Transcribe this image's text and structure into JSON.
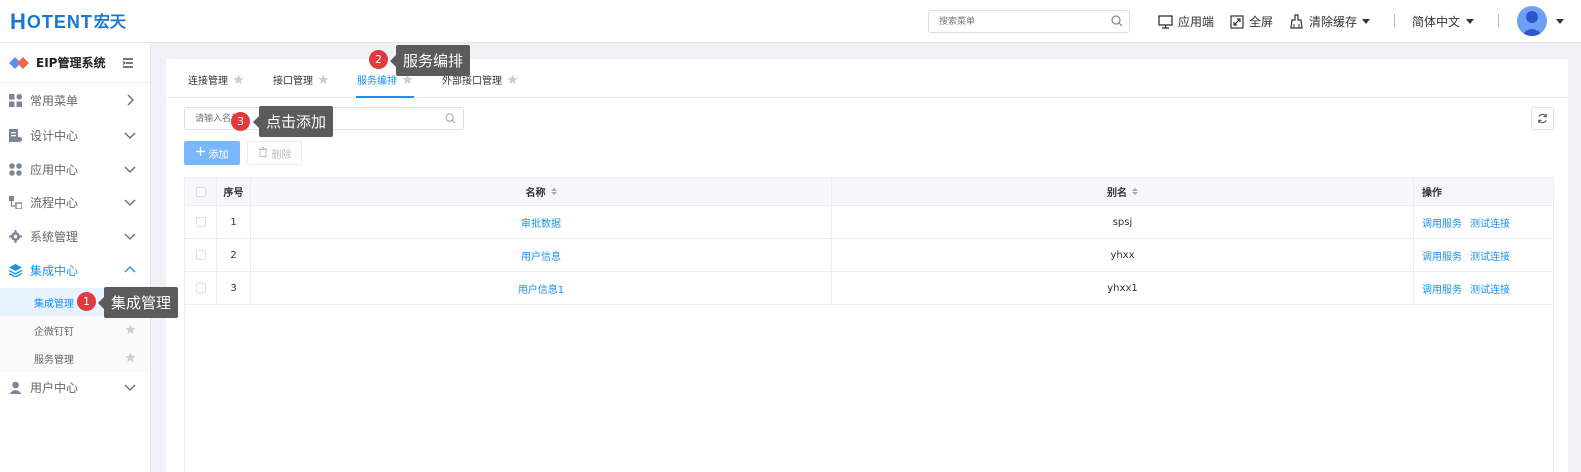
{
  "header": {
    "logo_main": "H",
    "logo_text": "OTENT",
    "logo_cn": "宏天",
    "search_placeholder": "搜索菜单",
    "app_client": "应用端",
    "fullscreen": "全屏",
    "clear_cache": "清除缓存",
    "language": "简体中文"
  },
  "sidebar": {
    "title": "EIP管理系统",
    "items": [
      {
        "label": "常用菜单",
        "icon": "grid-icon"
      },
      {
        "label": "设计中心",
        "icon": "design-icon"
      },
      {
        "label": "应用中心",
        "icon": "apps-icon"
      },
      {
        "label": "流程中心",
        "icon": "flow-icon"
      },
      {
        "label": "系统管理",
        "icon": "gear-icon"
      },
      {
        "label": "集成中心",
        "icon": "layers-icon"
      },
      {
        "label": "用户中心",
        "icon": "user-icon"
      }
    ],
    "subitems": [
      {
        "label": "集成管理"
      },
      {
        "label": "企微钉钉"
      },
      {
        "label": "服务管理"
      }
    ]
  },
  "tabs": [
    {
      "label": "连接管理"
    },
    {
      "label": "接口管理"
    },
    {
      "label": "服务编排"
    },
    {
      "label": "外部接口管理"
    }
  ],
  "toolbar": {
    "filter_placeholder": "请输入名称",
    "add_label": "添加",
    "delete_label": "删除"
  },
  "table": {
    "headers": {
      "index": "序号",
      "name": "名称",
      "alias": "别名",
      "ops": "操作"
    },
    "rows": [
      {
        "index": "1",
        "name": "审批数据",
        "alias": "spsj",
        "op1": "调用服务",
        "op2": "测试连接"
      },
      {
        "index": "2",
        "name": "用户信息",
        "alias": "yhxx",
        "op1": "调用服务",
        "op2": "测试连接"
      },
      {
        "index": "3",
        "name": "用户信息1",
        "alias": "yhxx1",
        "op1": "调用服务",
        "op2": "测试连接"
      }
    ]
  },
  "tips": [
    {
      "num": "1",
      "text": "集成管理"
    },
    {
      "num": "2",
      "text": "服务编排"
    },
    {
      "num": "3",
      "text": "点击添加"
    }
  ],
  "colors": {
    "accent": "#1890ff",
    "tip_bg": "#5b5b5b",
    "badge": "#e4393c",
    "logo": "#1677d6"
  }
}
